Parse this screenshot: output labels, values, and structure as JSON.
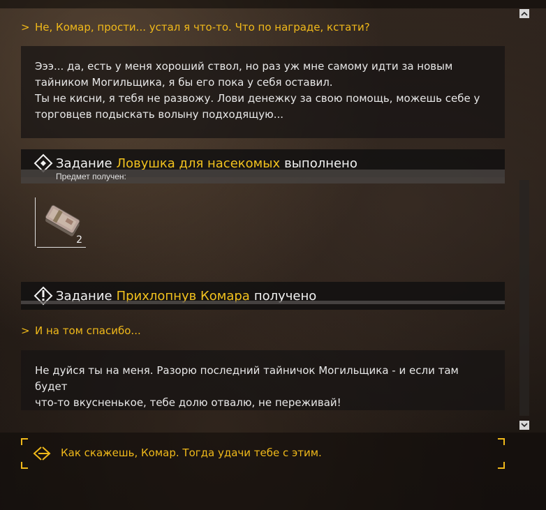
{
  "dialog": {
    "entries": [
      {
        "type": "player",
        "marker": ">",
        "text": "Не, Комар, прости... устал я что-то. Что по награде, кстати?"
      },
      {
        "type": "npc",
        "lines": [
          "Эээ... да, есть у меня хороший ствол, но раз уж мне самому идти за новым",
          "тайником Могильщика, я бы его пока у себя оставил.",
          "Ты не кисни, я тебя не развожу. Лови денежку за свою помощь, можешь себе у",
          "торговцев подыскать волыну подходящую..."
        ]
      },
      {
        "type": "quest",
        "prefix": "Задание",
        "name": "Ловушка для насекомых",
        "status": "выполнено",
        "icon": "diamond-target-icon"
      },
      {
        "type": "items",
        "label": "Предмет получен:",
        "item": {
          "icon": "money-stack-icon",
          "count": "2"
        }
      },
      {
        "type": "quest",
        "prefix": "Задание",
        "name": "Прихлопнув Комара",
        "status": "получено",
        "icon": "diamond-exclamation-icon"
      },
      {
        "type": "player",
        "marker": ">",
        "text": "И на том спасибо..."
      },
      {
        "type": "npc",
        "lines": [
          "Не дуйся ты на меня. Разорю последний тайничок Могильщика - и если там будет",
          "что-то вкусненькое, тебе долю отвалю, не переживай!"
        ]
      }
    ]
  },
  "scrollbar": {
    "up_glyph": "^",
    "down_glyph": "v"
  },
  "answer": {
    "text": "Как скажешь, Комар. Тогда удачи тебе с этим.",
    "icon": "exit-dialog-icon"
  },
  "colors": {
    "accent": "#f0b91a",
    "quest_name": "#f2c21e",
    "text": "#e8e8e8"
  }
}
